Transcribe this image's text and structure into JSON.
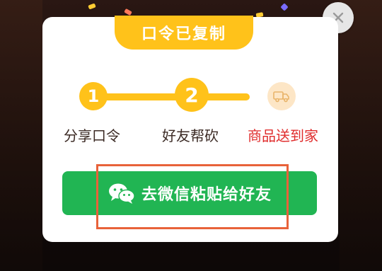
{
  "dialog": {
    "copied_banner": "口令已复制",
    "steps": [
      {
        "number": "1",
        "label": "分享口令"
      },
      {
        "number": "2",
        "label": "好友帮砍"
      },
      {
        "number": "",
        "label": "商品送到家"
      }
    ],
    "cta_label": "去微信粘贴给好友"
  },
  "colors": {
    "accent_yellow": "#ffc21a",
    "cta_green": "#21b553",
    "final_step_red": "#e02d2d",
    "highlight_orange": "#e8623a"
  },
  "icons": {
    "close": "close-icon",
    "truck": "delivery-truck-icon",
    "wechat": "wechat-icon"
  }
}
